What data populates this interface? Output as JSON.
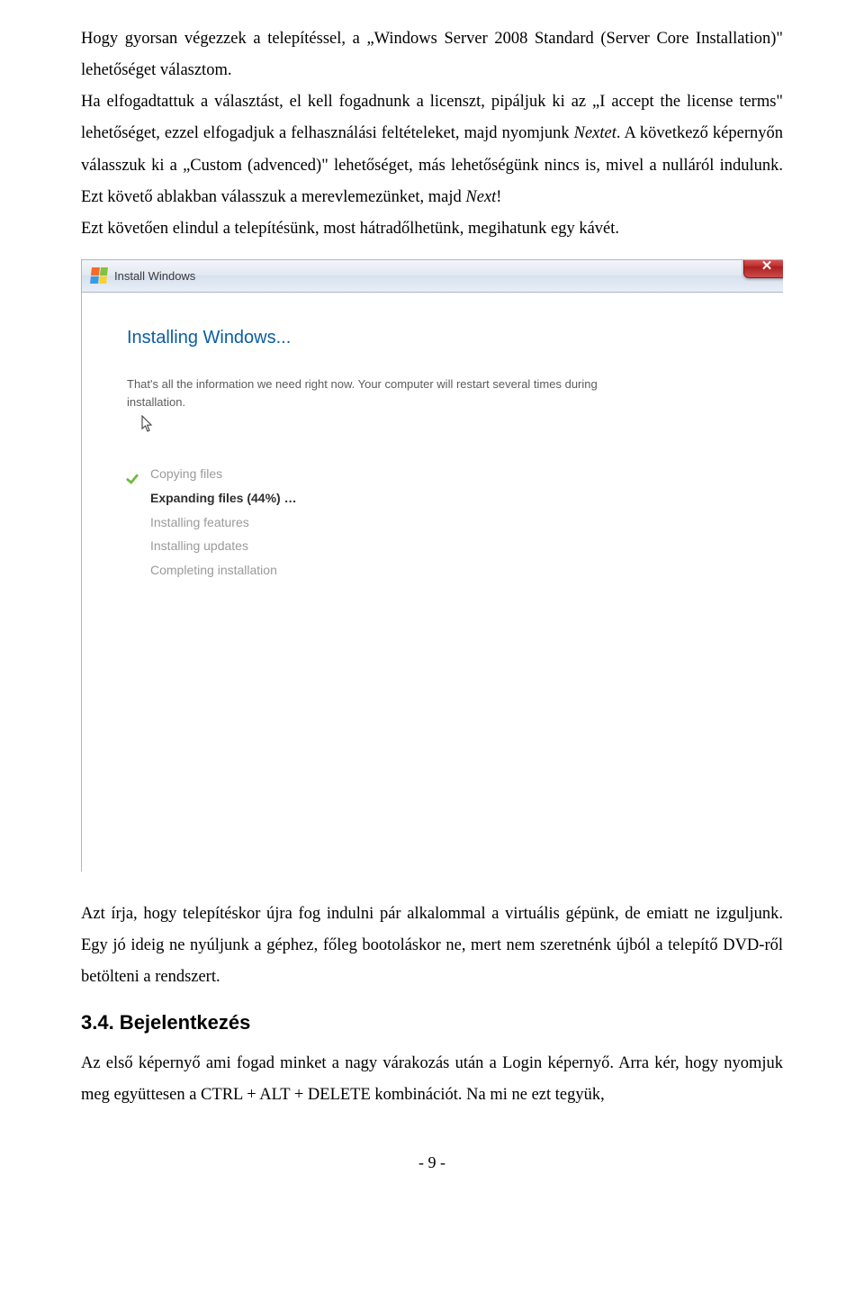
{
  "doc": {
    "para1": "Hogy gyorsan végezzek a telepítéssel, a „Windows Server 2008 Standard (Server Core Installation)\" lehetőséget választom.",
    "para2a": "Ha elfogadtattuk a választást, el kell fogadnunk a licenszt, pipáljuk ki az „I accept the license terms\" lehetőséget, ezzel elfogadjuk a felhasználási feltételeket, majd nyomjunk ",
    "para2b_italic": "Nextet",
    "para2c": ". A következő képernyőn válasszuk ki a „Custom (advenced)\" lehetőséget, más lehetőségünk nincs is, mivel a nulláról indulunk. Ezt követő ablakban válasszuk a merevlemezünket, majd ",
    "para2d_italic": "Next",
    "para2e": "!",
    "para3": "Ezt követően elindul a telepítésünk, most hátradőlhetünk, megihatunk egy kávét."
  },
  "installer": {
    "window_title": "Install Windows",
    "close_label": "✕",
    "heading": "Installing Windows...",
    "description": "That's all the information we need right now. Your computer will restart several times during installation.",
    "steps": {
      "copying": "Copying files",
      "expanding": "Expanding files (44%) …",
      "features": "Installing features",
      "updates": "Installing updates",
      "completing": "Completing installation"
    }
  },
  "after": {
    "para1": "Azt írja, hogy telepítéskor újra fog indulni pár alkalommal a virtuális gépünk, de emiatt ne izguljunk. Egy jó ideig ne nyúljunk a géphez, főleg bootoláskor ne, mert nem szeretnénk újból a telepítő DVD-ről betölteni a rendszert."
  },
  "section": {
    "heading": "3.4. Bejelentkezés",
    "body": "Az első képernyő ami fogad minket a nagy várakozás után a Login képernyő. Arra kér, hogy nyomjuk meg együttesen a CTRL + ALT + DELETE kombinációt. Na mi ne ezt tegyük,"
  },
  "page_number": "- 9 -"
}
